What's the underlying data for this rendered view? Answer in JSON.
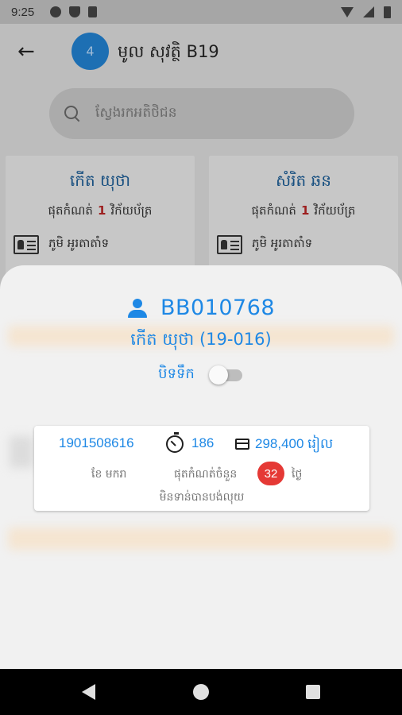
{
  "status_bar": {
    "time": "9:25",
    "left_icons": [
      "gear-icon",
      "shield-icon",
      "sd-card-icon"
    ],
    "right_icons": [
      "wifi-icon",
      "signal-icon",
      "battery-icon"
    ]
  },
  "app_bar": {
    "avatar_text": "4",
    "title": "មូល សុវត្ថិ B19"
  },
  "search": {
    "placeholder": "ស្វែងរកអតិថិជន"
  },
  "customer_cards": [
    {
      "name": "កើត យុថា",
      "note_prefix": "ផុតកំណត់",
      "note_count": "1",
      "note_suffix": "វិក័យប័ត្រ",
      "location": "ភូមិ អូរតាតាំទ"
    },
    {
      "name": "សំរិត ឆន",
      "note_prefix": "ផុតកំណត់",
      "note_count": "1",
      "note_suffix": "វិក័យប័ត្រ",
      "location": "ភូមិ អូរតាតាំទ"
    }
  ],
  "sheet": {
    "account_id": "BB010768",
    "customer_name": "កើត យុថា (19-016)",
    "toggle_label": "បិទទឹក",
    "toggle_on": false,
    "info": {
      "phone": "1901508616",
      "days": "186",
      "amount": "298,400 រៀល",
      "month": "ខែ មករា",
      "due_label": "ផុតកំណត់ចំនួន",
      "overdue_days": "32",
      "day_unit": "ថ្ងៃ",
      "payment_status": "មិនទាន់បានបង់លុយ"
    }
  },
  "nav_bar": {
    "buttons": [
      "back-icon",
      "home-icon",
      "recents-icon"
    ]
  },
  "colors": {
    "accent": "#1e88e5",
    "badge": "#e53935",
    "avatar": "#1d6fb3"
  }
}
